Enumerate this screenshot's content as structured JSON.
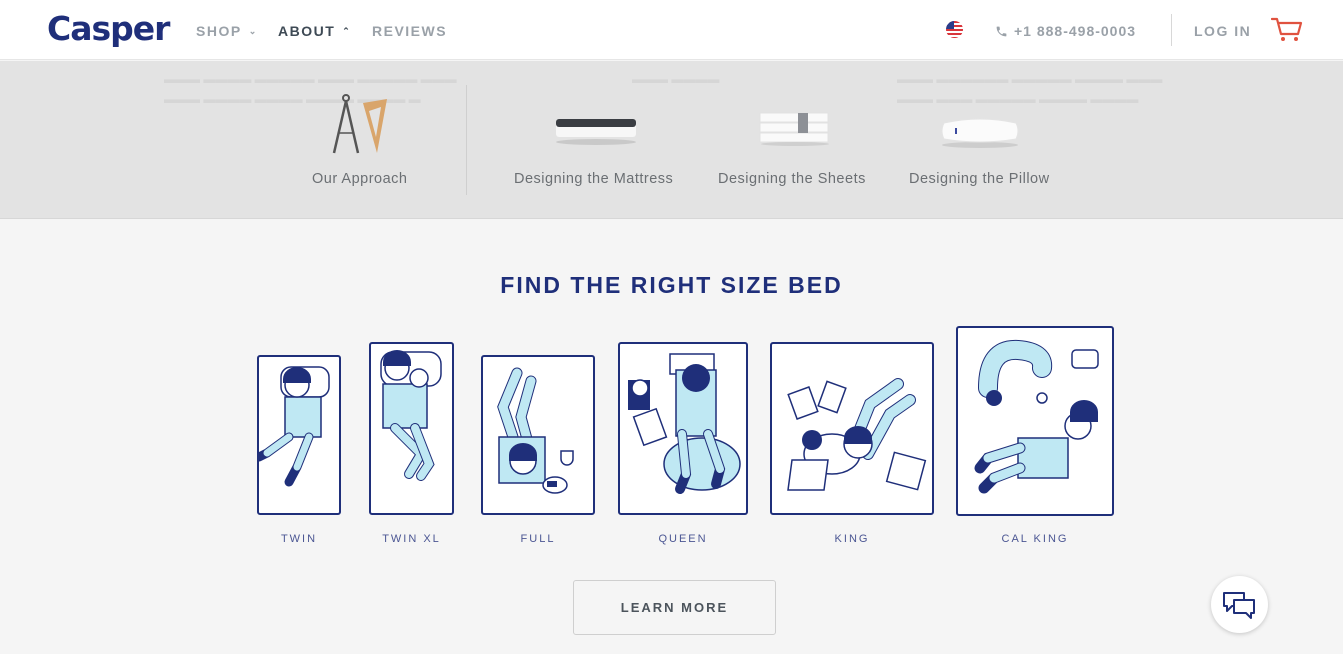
{
  "header": {
    "logo": "Casper",
    "nav": [
      {
        "label": "SHOP",
        "chevron": "down"
      },
      {
        "label": "ABOUT",
        "chevron": "up"
      },
      {
        "label": "REVIEWS"
      }
    ],
    "phone": "+1 888-498-0003",
    "login": "LOG IN",
    "flag_icon": "us-flag-icon",
    "cart_icon": "cart-icon"
  },
  "subnav": {
    "items": [
      {
        "label": "Our Approach",
        "icon": "compass-ruler-icon"
      },
      {
        "label": "Designing the Mattress",
        "icon": "mattress-icon"
      },
      {
        "label": "Designing the Sheets",
        "icon": "sheets-icon"
      },
      {
        "label": "Designing the Pillow",
        "icon": "pillow-icon"
      }
    ]
  },
  "section": {
    "title": "FIND THE RIGHT SIZE BED",
    "beds": [
      {
        "label": "TWIN"
      },
      {
        "label": "TWIN XL"
      },
      {
        "label": "FULL"
      },
      {
        "label": "QUEEN"
      },
      {
        "label": "KING"
      },
      {
        "label": "CAL KING"
      }
    ],
    "cta": "LEARN MORE"
  },
  "colors": {
    "brand": "#1f2f7a",
    "accent_cart": "#e0523f",
    "illustration_fill": "#bfe8f3"
  },
  "chat_icon": "chat-bubbles-icon"
}
